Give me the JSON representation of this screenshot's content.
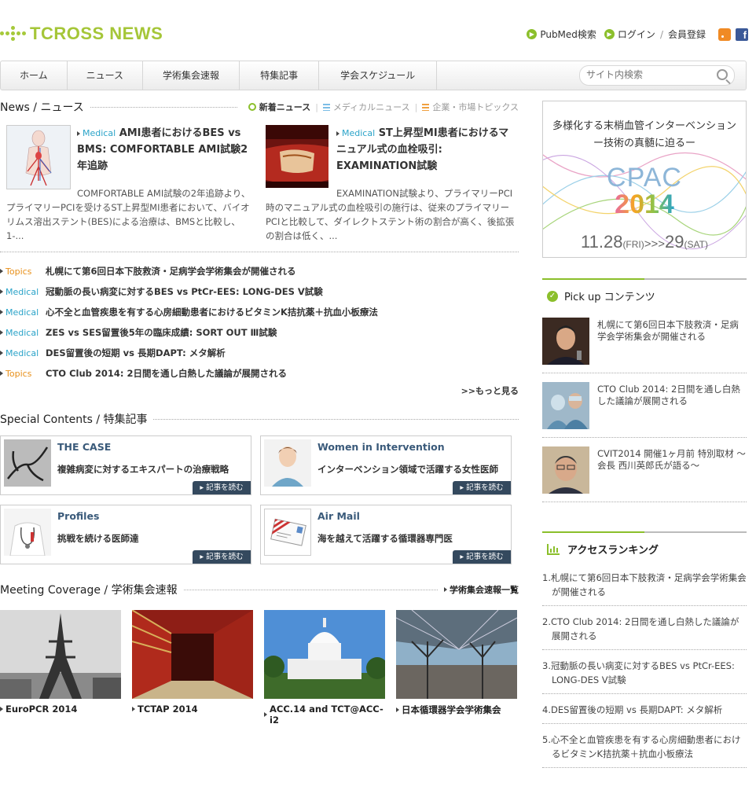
{
  "header": {
    "logo_text": "TCROSS NEWS",
    "links": [
      "PubMed検索",
      "ログイン",
      "会員登録"
    ],
    "link_sep": "/"
  },
  "nav": {
    "items": [
      "ホーム",
      "ニュース",
      "学術集会速報",
      "特集記事",
      "学会スケジュール"
    ],
    "search_placeholder": "サイト内検索"
  },
  "news": {
    "heading": "News / ニュース",
    "tabs": [
      "新着ニュース",
      "メディカルニュース",
      "企業・市場トピックス"
    ],
    "featured": [
      {
        "category": "Medical",
        "title": "AMI患者におけるBES vs BMS: COMFORTABLE AMI試験2年追跡",
        "desc": "COMFORTABLE AMI試験の2年追跡より、プライマリーPCIを受けるST上昇型MI患者において、バイオリムス溶出ステント(BES)による治療は、BMSと比較し、1-..."
      },
      {
        "category": "Medical",
        "title": "ST上昇型MI患者におけるマニュアル式の血栓吸引: EXAMINATION試験",
        "desc": "EXAMINATION試験より、プライマリーPCI時のマニュアル式の血栓吸引の施行は、従来のプライマリーPCIと比較して、ダイレクトステント術の割合が高く、後拡張の割合は低く、..."
      }
    ],
    "headlines": [
      {
        "category": "Topics",
        "title": "札幌にて第6回日本下肢救済・足病学会学術集会が開催される"
      },
      {
        "category": "Medical",
        "title": "冠動脈の長い病変に対するBES vs PtCr-EES: LONG-DES Ⅴ試験"
      },
      {
        "category": "Medical",
        "title": "心不全と血管疾患を有する心房細動患者におけるビタミンK拮抗薬＋抗血小板療法"
      },
      {
        "category": "Medical",
        "title": "ZES vs SES留置後5年の臨床成績: SORT OUT Ⅲ試験"
      },
      {
        "category": "Medical",
        "title": "DES留置後の短期 vs 長期DAPT: メタ解析"
      },
      {
        "category": "Topics",
        "title": "CTO Club 2014: 2日間を通し白熱した議論が展開される"
      }
    ],
    "more": ">>もっと見る"
  },
  "special": {
    "heading": "Special Contents / 特集記事",
    "read_label": "記事を読む",
    "items": [
      {
        "name": "THE CASE",
        "sub": "複雑病変に対するエキスパートの治療戦略"
      },
      {
        "name": "Women in Intervention",
        "sub": "インターベンション領域で活躍する女性医師"
      },
      {
        "name": "Profiles",
        "sub": "挑戦を続ける医師達"
      },
      {
        "name": "Air Mail",
        "sub": "海を越えて活躍する循環器専門医"
      }
    ]
  },
  "meeting": {
    "heading": "Meeting Coverage / 学術集会速報",
    "list_link": "学術集会速報一覧",
    "items": [
      "EuroPCR 2014",
      "TCTAP 2014",
      "ACC.14 and TCT@ACC-i2",
      "日本循環器学会学術集会"
    ]
  },
  "banner": {
    "line1": "多様化する末梢血管インターベンション",
    "line2": "ー技術の真髄に迫るー",
    "brand": "CPAC",
    "year": "2014",
    "date_from": "11.28",
    "day_from": "(FRI)",
    "arrows": ">>>",
    "date_to": "29",
    "day_to": "(SAT)"
  },
  "pickup": {
    "heading": "Pick up コンテンツ",
    "items": [
      "札幌にて第6回日本下肢救済・足病学会学術集会が開催される",
      "CTO Club 2014: 2日間を通し白熱した議論が展開される",
      "CVIT2014 開催1ヶ月前 特別取材 〜会長 西川英郎氏が語る〜"
    ]
  },
  "ranking": {
    "heading": "アクセスランキング",
    "items": [
      "1.札幌にて第6回日本下肢救済・足病学会学術集会が開催される",
      "2.CTO Club 2014: 2日間を通し白熱した議論が展開される",
      "3.冠動脈の長い病変に対するBES vs PtCr-EES: LONG-DES Ⅴ試験",
      "4.DES留置後の短期 vs 長期DAPT: メタ解析",
      "5.心不全と血管疾患を有する心房細動患者におけるビタミンK拮抗薬＋抗血小板療法"
    ]
  },
  "colors": {
    "brand_green": "#a5c638",
    "medical_blue": "#2aa3c8",
    "topics_orange": "#e8901a",
    "button_navy": "#34495e"
  }
}
